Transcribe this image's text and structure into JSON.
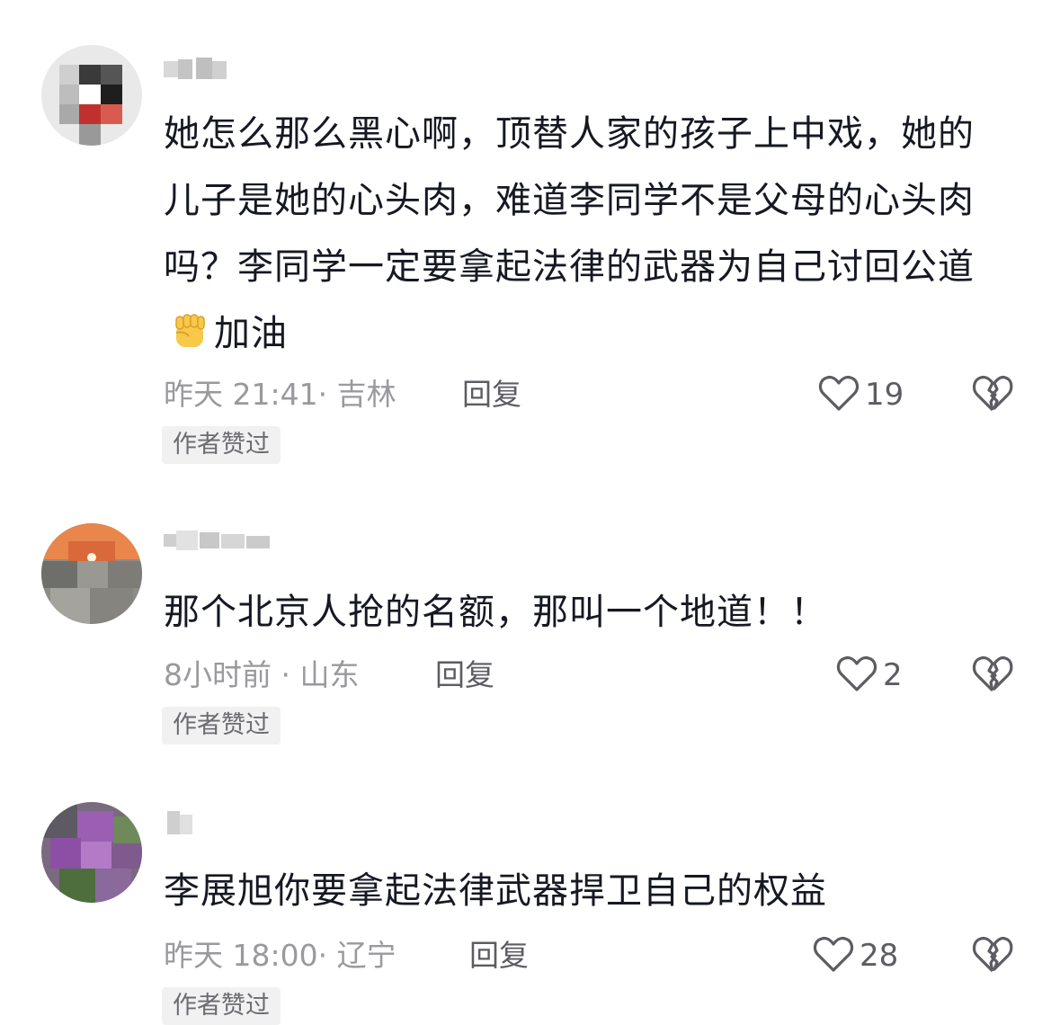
{
  "comments": [
    {
      "text_pre": "她怎么那么黑心啊，顶替人家的孩子上中戏，她的儿子是她的心头肉，难道李同学不是父母的心头肉吗？李同学一定要拿起法律的武器为自己讨回公道",
      "emoji_name": "raised-fist-emoji",
      "text_post": "加油",
      "meta": "昨天 21:41· 吉林",
      "reply_label": "回复",
      "likes": "19",
      "badge": "作者赞过"
    },
    {
      "text_pre": "那个北京人抢的名额，那叫一个地道！！",
      "meta": "8小时前 · 山东",
      "reply_label": "回复",
      "likes": "2",
      "badge": "作者赞过"
    },
    {
      "text_pre": "李展旭你要拿起法律武器捍卫自己的权益",
      "meta": "昨天 18:00· 辽宁",
      "reply_label": "回复",
      "likes": "28",
      "badge": "作者赞过"
    }
  ],
  "icons": {
    "like": "heart-outline-icon",
    "dislike": "broken-heart-icon"
  },
  "colors": {
    "text": "#161823",
    "meta": "#9a9a9e",
    "reply": "#5c5c62",
    "badge_bg": "#f1f1f2"
  }
}
